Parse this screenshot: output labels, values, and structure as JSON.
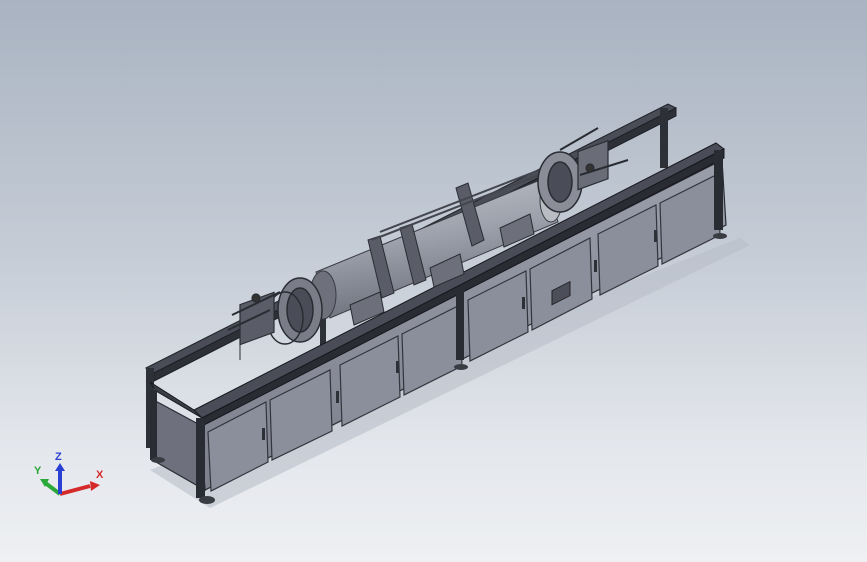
{
  "viewport": {
    "name": "cad-graphics-area",
    "colors": {
      "bg_top": "#a9b3c1",
      "bg_bottom": "#eef0f3",
      "cabinet": "#8d909c",
      "frame": "#2e3038",
      "drum": "#9ea2ac"
    }
  },
  "triad": {
    "x_label": "X",
    "y_label": "Y",
    "z_label": "Z",
    "x_color": "#d42a2a",
    "y_color": "#2aa838",
    "z_color": "#2a3fd4"
  }
}
